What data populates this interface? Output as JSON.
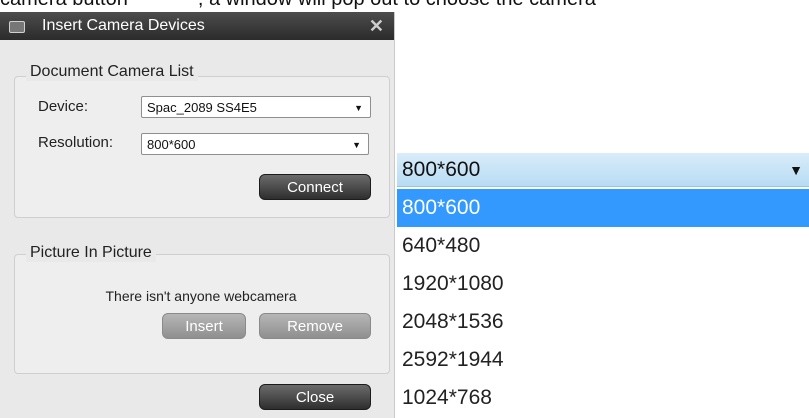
{
  "caption": {
    "left": "camera button",
    "right": ", a window will pop out to choose the camera"
  },
  "dialog": {
    "title": "Insert Camera Devices",
    "close_glyph": "✕",
    "document_camera": {
      "group_label": "Document Camera List",
      "device_label": "Device:",
      "device_value": "Spac_2089 SS4E5",
      "resolution_label": "Resolution:",
      "resolution_value": "800*600",
      "connect_label": "Connect"
    },
    "picture_in_picture": {
      "group_label": "Picture In Picture",
      "message": "There isn't anyone webcamera",
      "insert_label": "Insert",
      "remove_label": "Remove"
    },
    "close_label": "Close"
  },
  "dropdown": {
    "selected_value": "800*600",
    "options": [
      "800*600",
      "640*480",
      "1920*1080",
      "2048*1536",
      "2592*1944",
      "1024*768"
    ],
    "highlighted_index": 0
  },
  "colors": {
    "highlight": "#3399ff",
    "titlebar": "#3a3a3a"
  }
}
